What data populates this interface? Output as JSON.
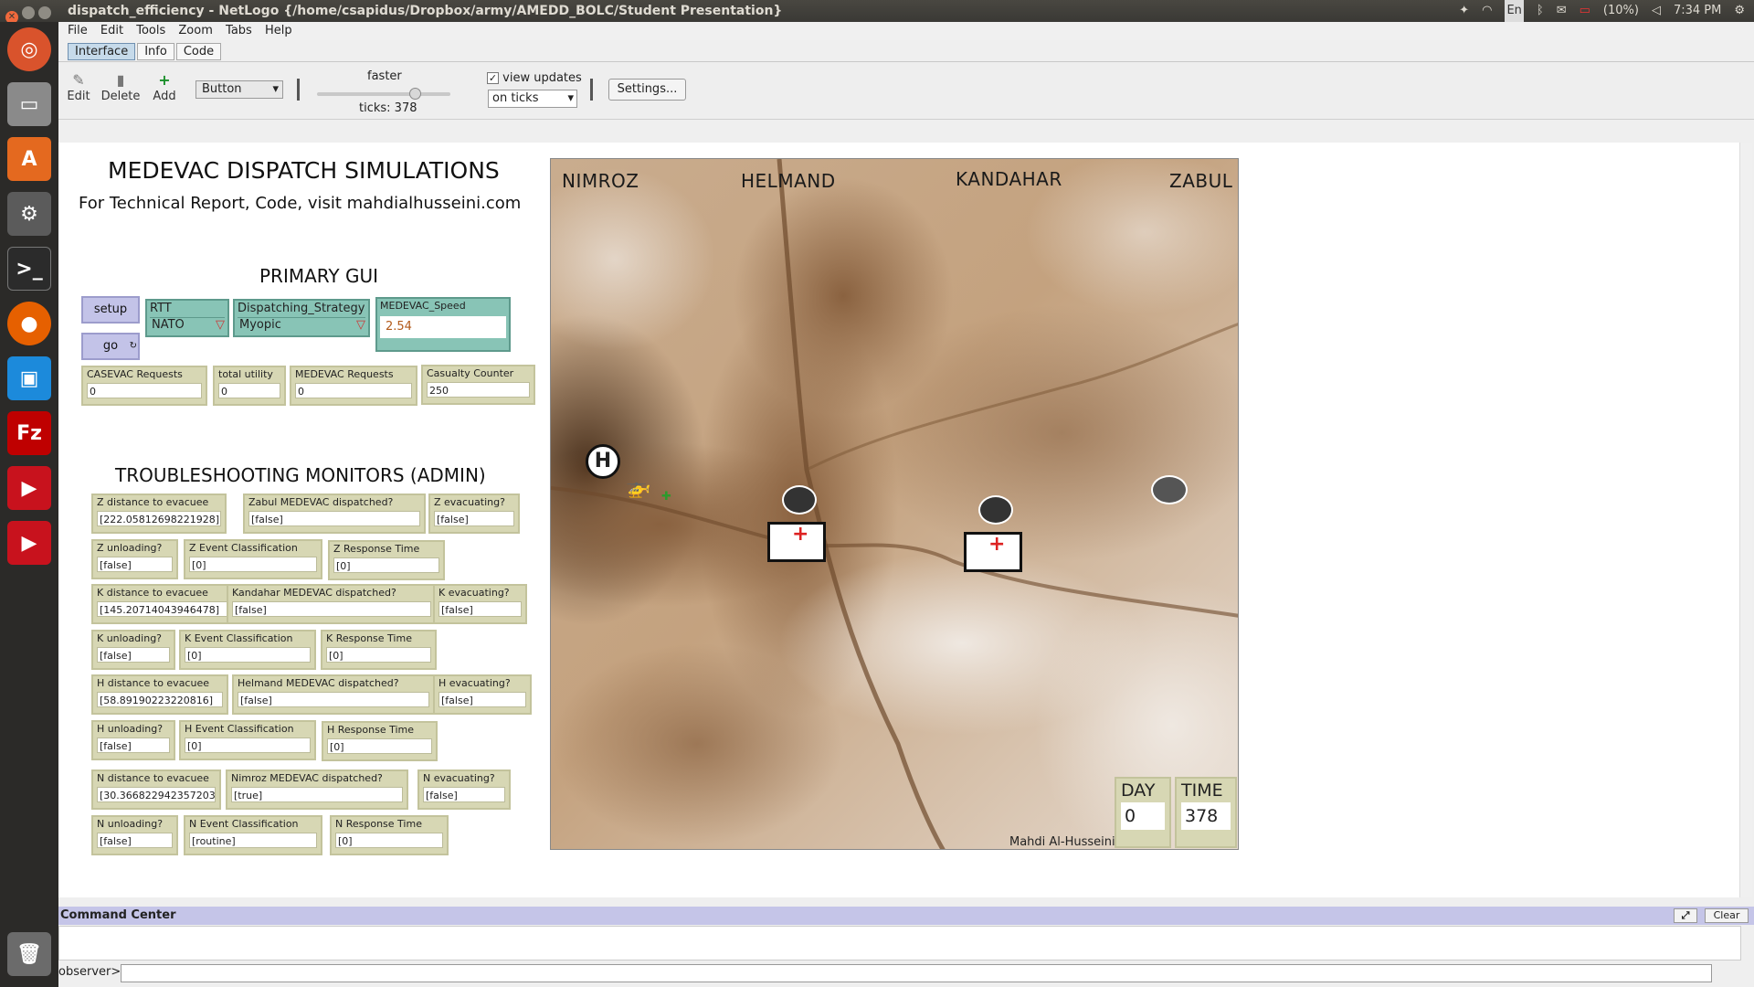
{
  "window": {
    "title": "dispatch_efficiency - NetLogo {/home/csapidus/Dropbox/army/AMEDD_BOLC/Student Presentation}"
  },
  "tray": {
    "lang": "En",
    "battery": "(10%)",
    "time": "7:34 PM"
  },
  "menu": [
    "File",
    "Edit",
    "Tools",
    "Zoom",
    "Tabs",
    "Help"
  ],
  "tabs": [
    "Interface",
    "Info",
    "Code"
  ],
  "toolbar": {
    "edit": "Edit",
    "delete": "Delete",
    "add": "Add",
    "widget": "Button",
    "speed_label": "faster",
    "ticks": "ticks: 378",
    "view_updates": "view updates",
    "update_mode": "on ticks",
    "settings": "Settings..."
  },
  "iface": {
    "title": "MEDEVAC DISPATCH SIMULATIONS",
    "subtitle": "For Technical Report, Code, visit mahdialhusseini.com",
    "primary": "PRIMARY GUI",
    "trouble": "TROUBLESHOOTING MONITORS (ADMIN)",
    "setup": "setup",
    "go": "go",
    "rtt": {
      "label": "RTT",
      "value": "NATO"
    },
    "strategy": {
      "label": "Dispatching_Strategy",
      "value": "Myopic"
    },
    "speed": {
      "label": "MEDEVAC_Speed",
      "value": "2.54"
    },
    "monitors": {
      "casevac": {
        "label": "CASEVAC Requests",
        "value": "0"
      },
      "utility": {
        "label": "total utility",
        "value": "0"
      },
      "medevac": {
        "label": "MEDEVAC Requests",
        "value": "0"
      },
      "casualty": {
        "label": "Casualty Counter",
        "value": "250"
      },
      "z_dist": {
        "label": "Z distance to evacuee",
        "value": "[222.05812698221928]"
      },
      "z_disp": {
        "label": "Zabul MEDEVAC dispatched?",
        "value": "[false]"
      },
      "z_evac": {
        "label": "Z evacuating?",
        "value": "[false]"
      },
      "z_unl": {
        "label": "Z unloading?",
        "value": "[false]"
      },
      "z_class": {
        "label": "Z Event Classification",
        "value": "[0]"
      },
      "z_resp": {
        "label": "Z Response Time",
        "value": "[0]"
      },
      "k_dist": {
        "label": "K distance to evacuee",
        "value": "[145.20714043946478]"
      },
      "k_disp": {
        "label": "Kandahar MEDEVAC dispatched?",
        "value": "[false]"
      },
      "k_evac": {
        "label": "K evacuating?",
        "value": "[false]"
      },
      "k_unl": {
        "label": "K unloading?",
        "value": "[false]"
      },
      "k_class": {
        "label": "K Event Classification",
        "value": "[0]"
      },
      "k_resp": {
        "label": "K Response Time",
        "value": "[0]"
      },
      "h_dist": {
        "label": "H distance to evacuee",
        "value": "[58.89190223220816]"
      },
      "h_disp": {
        "label": "Helmand MEDEVAC dispatched?",
        "value": "[false]"
      },
      "h_evac": {
        "label": "H evacuating?",
        "value": "[false]"
      },
      "h_unl": {
        "label": "H unloading?",
        "value": "[false]"
      },
      "h_class": {
        "label": "H Event Classification",
        "value": "[0]"
      },
      "h_resp": {
        "label": "H Response Time",
        "value": "[0]"
      },
      "n_dist": {
        "label": "N distance to evacuee",
        "value": "[30.366822942357203]"
      },
      "n_disp": {
        "label": "Nimroz MEDEVAC dispatched?",
        "value": "[true]"
      },
      "n_evac": {
        "label": "N evacuating?",
        "value": "[false]"
      },
      "n_unl": {
        "label": "N unloading?",
        "value": "[false]"
      },
      "n_class": {
        "label": "N Event Classification",
        "value": "[routine]"
      },
      "n_resp": {
        "label": "N Response Time",
        "value": "[0]"
      }
    },
    "world": {
      "nimroz": "NIMROZ",
      "helmand": "HELMAND",
      "kandahar": "KANDAHAR",
      "zabul": "ZABUL",
      "author": "Mahdi Al-Husseini",
      "helipad": "H",
      "day_label": "DAY",
      "day": "0",
      "time_label": "TIME",
      "time": "378"
    }
  },
  "command": {
    "title": "Command Center",
    "clear": "Clear",
    "prompt": "observer>"
  }
}
